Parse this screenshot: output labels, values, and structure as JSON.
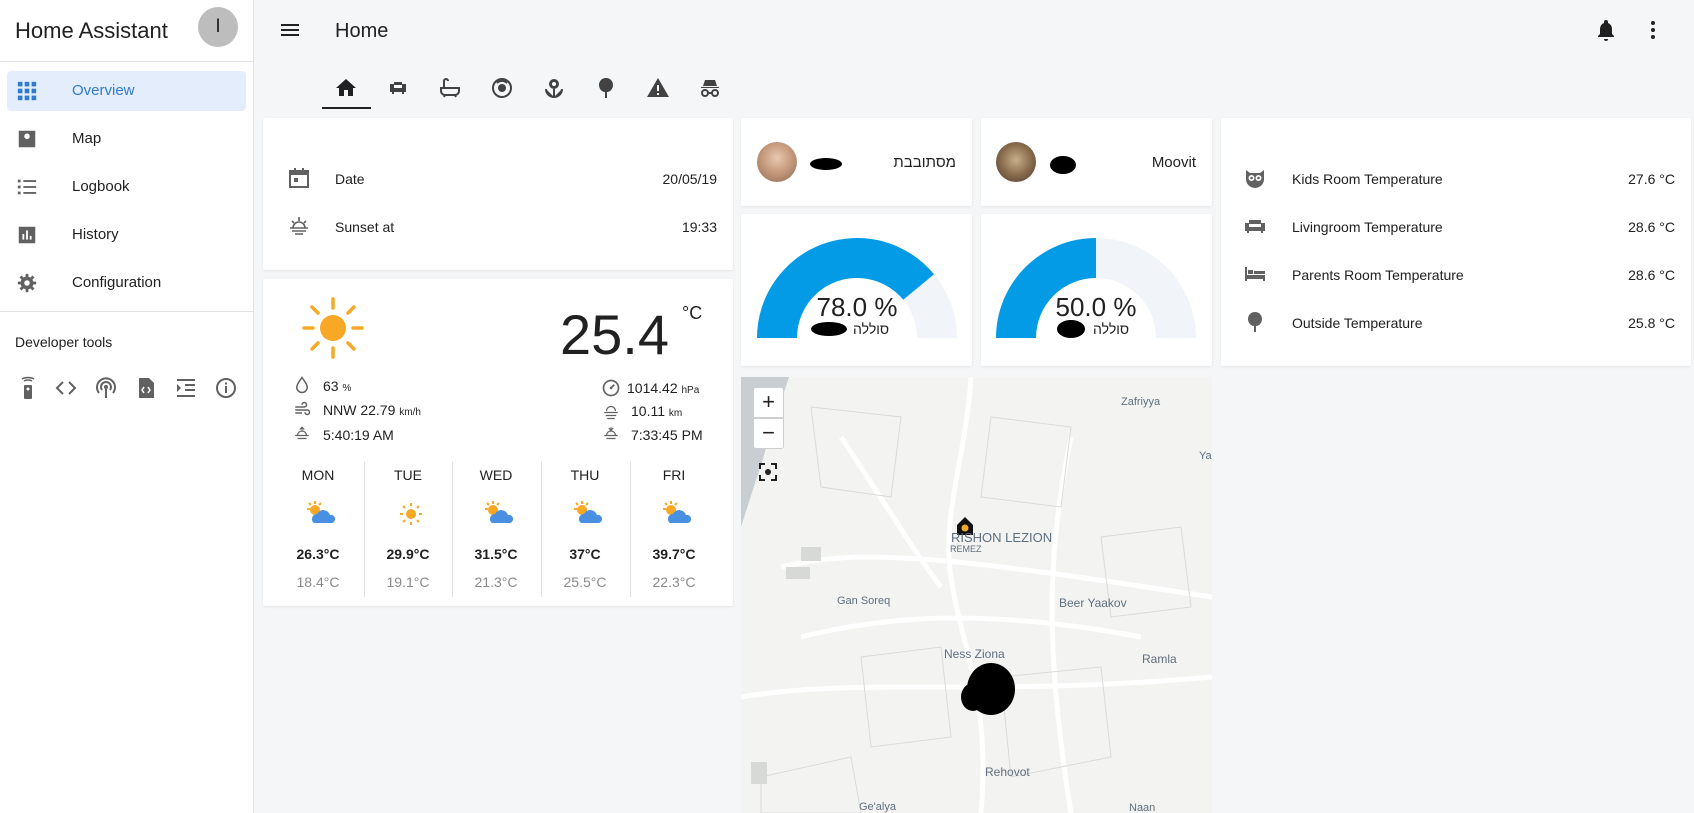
{
  "app": {
    "title": "Home Assistant",
    "avatar_letter": "I"
  },
  "sidebar": {
    "items": [
      {
        "label": "Overview",
        "icon": "grid-icon",
        "active": true
      },
      {
        "label": "Map",
        "icon": "account-box-icon"
      },
      {
        "label": "Logbook",
        "icon": "format-list-bulleted-icon"
      },
      {
        "label": "History",
        "icon": "chart-box-icon"
      },
      {
        "label": "Configuration",
        "icon": "gear-icon"
      }
    ],
    "dev_tools_title": "Developer tools",
    "dev_tools": [
      "remote-icon",
      "code-tags-icon",
      "broadcast-icon",
      "file-code-icon",
      "format-indent-icon",
      "info-icon"
    ]
  },
  "header": {
    "title": "Home",
    "tabs": [
      "home-icon",
      "sofa-icon",
      "bathtub-icon",
      "robot-vacuum-icon",
      "flower-icon",
      "tree-icon",
      "alert-icon",
      "incognito-icon"
    ],
    "active_tab": 0
  },
  "info_card": {
    "rows": [
      {
        "label": "Date",
        "value": "20/05/19",
        "icon": "calendar-icon"
      },
      {
        "label": "Sunset at",
        "value": "19:33",
        "icon": "weather-sunset-icon"
      }
    ]
  },
  "weather": {
    "temperature": "25.4",
    "unit": "°C",
    "humidity": "63",
    "humidity_unit": "%",
    "wind": "NNW 22.79",
    "wind_unit": "km/h",
    "sunrise": "5:40:19 AM",
    "pressure": "1014.42",
    "pressure_unit": "hPa",
    "visibility": "10.11",
    "visibility_unit": "km",
    "sunset": "7:33:45 PM",
    "forecast": [
      {
        "day": "MON",
        "high": "26.3°C",
        "low": "18.4°C",
        "icon": "partly-cloudy-icon"
      },
      {
        "day": "TUE",
        "high": "29.9°C",
        "low": "19.1°C",
        "icon": "sunny-icon"
      },
      {
        "day": "WED",
        "high": "31.5°C",
        "low": "21.3°C",
        "icon": "partly-cloudy-icon"
      },
      {
        "day": "THU",
        "high": "37°C",
        "low": "25.5°C",
        "icon": "partly-cloudy-icon"
      },
      {
        "day": "FRI",
        "high": "39.7°C",
        "low": "22.3°C",
        "icon": "partly-cloudy-icon"
      }
    ]
  },
  "persons": [
    {
      "state": "מסתובבת"
    },
    {
      "state": "Moovit"
    }
  ],
  "gauges": [
    {
      "value": "78.0 %",
      "fraction": 0.78,
      "name": "סוללה"
    },
    {
      "value": "50.0 %",
      "fraction": 0.5,
      "name": "סוללה"
    }
  ],
  "sensors": [
    {
      "label": "Kids Room Temperature",
      "value": "27.6 °C",
      "icon": "owl-icon"
    },
    {
      "label": "Livingroom Temperature",
      "value": "28.6 °C",
      "icon": "sofa-icon"
    },
    {
      "label": "Parents Room Temperature",
      "value": "28.6 °C",
      "icon": "bed-icon"
    },
    {
      "label": "Outside Temperature",
      "value": "25.8 °C",
      "icon": "tree-icon"
    }
  ],
  "map": {
    "zoom_in": "+",
    "zoom_out": "−",
    "labels": [
      "Zafriyya",
      "Ya",
      "RISHON LEZION",
      "REMEZ",
      "Gan Soreq",
      "Beer Yaakov",
      "Ness Ziona",
      "Ramla",
      "Rehovot",
      "Ge'alya",
      "Naan"
    ]
  },
  "colors": {
    "accent": "#2f7bd0",
    "gauge": "#039be5",
    "gauge_bg": "#f1f4f8",
    "sun": "#f9a825"
  }
}
